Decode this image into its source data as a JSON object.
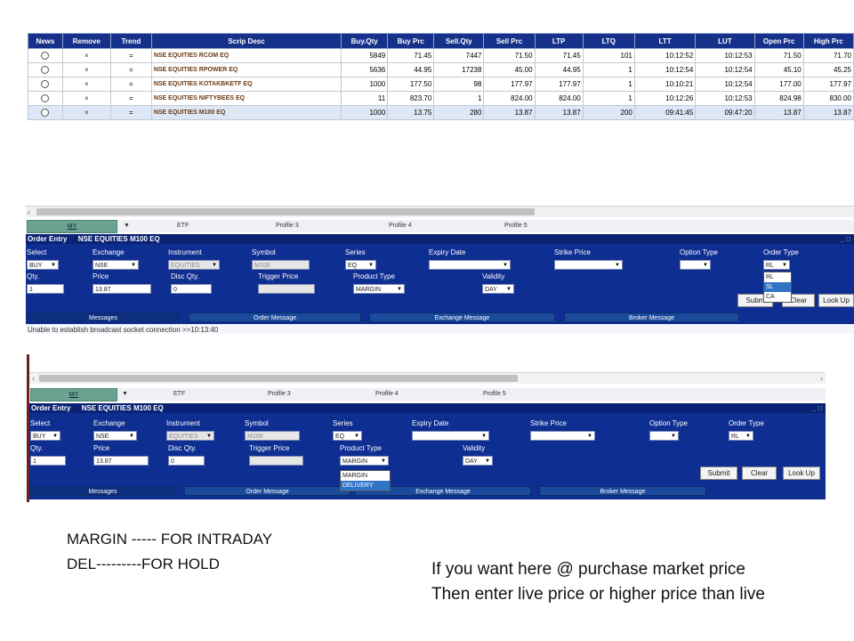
{
  "market_watch": {
    "columns": [
      "News",
      "Remove",
      "Trend",
      "Scrip Desc",
      "Buy.Qty",
      "Buy Prc",
      "Sell.Qty",
      "Sell Prc",
      "LTP",
      "LTQ",
      "LTT",
      "LUT",
      "Open Prc",
      "High Prc"
    ],
    "rows": [
      {
        "remove": "×",
        "trend": "=",
        "desc": "NSE EQUITIES RCOM EQ",
        "buy_qty": "5849",
        "buy_prc": "71.45",
        "sell_qty": "7447",
        "sell_prc": "71.50",
        "ltp": "71.45",
        "ltq": "101",
        "ltt": "10:12:52",
        "lut": "10:12:53",
        "open": "71.50",
        "high": "71.70"
      },
      {
        "remove": "×",
        "trend": "=",
        "desc": "NSE EQUITIES RPOWER EQ",
        "buy_qty": "5636",
        "buy_prc": "44.95",
        "sell_qty": "17238",
        "sell_prc": "45.00",
        "ltp": "44.95",
        "ltq": "1",
        "ltt": "10:12:54",
        "lut": "10:12:54",
        "open": "45.10",
        "high": "45.25"
      },
      {
        "remove": "×",
        "trend": "=",
        "desc": "NSE EQUITIES KOTAKBKETF EQ",
        "buy_qty": "1000",
        "buy_prc": "177.50",
        "sell_qty": "98",
        "sell_prc": "177.97",
        "ltp": "177.97",
        "ltq": "1",
        "ltt": "10:10:21",
        "lut": "10:12:54",
        "open": "177.00",
        "high": "177.97"
      },
      {
        "remove": "×",
        "trend": "=",
        "desc": "NSE EQUITIES NIFTYBEES EQ",
        "buy_qty": "11",
        "buy_prc": "823.70",
        "sell_qty": "1",
        "sell_prc": "824.00",
        "ltp": "824.00",
        "ltq": "1",
        "ltt": "10:12:26",
        "lut": "10:12:53",
        "open": "824.98",
        "high": "830.00"
      },
      {
        "remove": "×",
        "trend": "=",
        "desc": "NSE EQUITIES M100 EQ",
        "buy_qty": "1000",
        "buy_prc": "13.75",
        "sell_qty": "280",
        "sell_prc": "13.87",
        "ltp": "13.87",
        "ltq": "200",
        "ltt": "09:41:45",
        "lut": "09:47:20",
        "open": "13.87",
        "high": "13.87"
      }
    ]
  },
  "tabs": [
    "MY",
    "ETF",
    "Profile 3",
    "Profile 4",
    "Profile 5"
  ],
  "tab_dropdown": "▼",
  "scroll_left": "‹",
  "scroll_right": "›",
  "caret": "▼",
  "order_entry": {
    "title": "Order Entry",
    "scrip": "NSE EQUITIES M100 EQ",
    "window_controls": "_ □",
    "labels": {
      "select": "Select",
      "exchange": "Exchange",
      "instrument": "Instrument",
      "symbol": "Symbol",
      "series": "Series",
      "expiry": "Expiry Date",
      "strike": "Strike Price",
      "option_type": "Option Type",
      "order_type": "Order Type",
      "qty": "Qty.",
      "price": "Price",
      "disc_qty": "Disc Qty.",
      "trigger": "Trigger Price",
      "product_type": "Product Type",
      "validity": "Validity"
    },
    "values": {
      "select": "BUY",
      "exchange": "NSE",
      "instrument": "EQUITIES",
      "symbol": "M100",
      "series": "EQ",
      "order_type": "RL",
      "qty": "1",
      "price": "13.87",
      "disc_qty": "0",
      "product_type": "MARGIN",
      "validity": "DAY"
    },
    "order_type_options": [
      "RL",
      "SL",
      "CA"
    ],
    "product_type_options": [
      "MARGIN",
      "DELIVERY"
    ],
    "buttons": {
      "submit": "Submit",
      "submit_clipped": "Subm",
      "clear": "Clear",
      "clear_clipped": "Clear",
      "lookup": "Look Up"
    },
    "message_tabs": [
      "Messages",
      "Order Message",
      "Exchange Message",
      "Broker Message"
    ],
    "status_line": "Unable to establish broadcast socket connection >>10:13:40"
  },
  "notes": {
    "margin": "MARGIN -----   FOR INTRADAY",
    "del": "DEL---------FOR  HOLD",
    "tip_line1": "If you want here @ purchase market price",
    "tip_line2": "Then enter live price or higher price than live"
  },
  "colors": {
    "panel": "#0f2e92",
    "header": "#16318a",
    "active_tab": "#6aa38f",
    "highlight": "#2f74c7",
    "scrip_text": "#6b3a12"
  }
}
